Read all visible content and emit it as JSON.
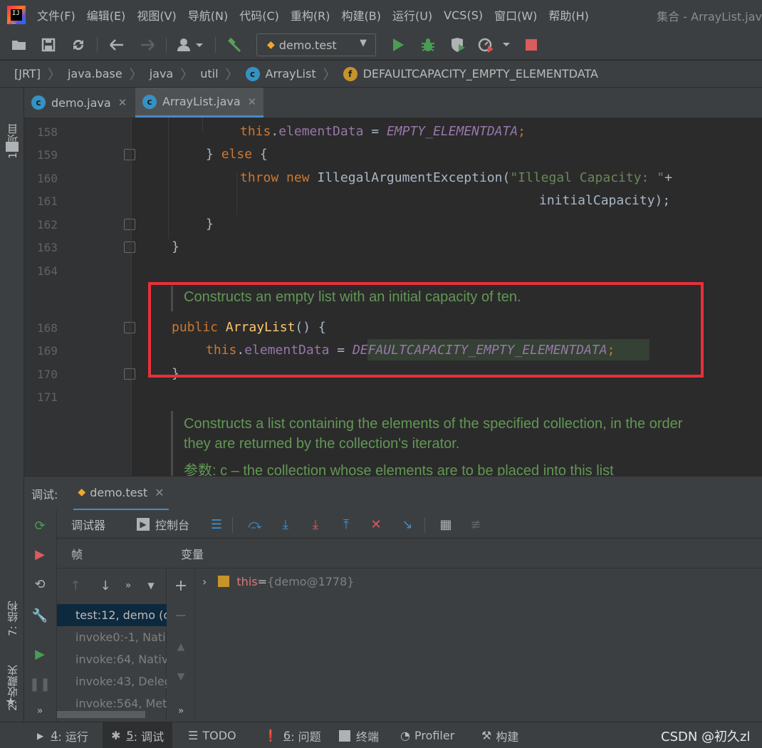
{
  "app": {
    "window_title": "集合 - ArrayList.jav"
  },
  "menu": [
    "文件(F)",
    "编辑(E)",
    "视图(V)",
    "导航(N)",
    "代码(C)",
    "重构(R)",
    "构建(B)",
    "运行(U)",
    "VCS(S)",
    "窗口(W)",
    "帮助(H)"
  ],
  "toolbar": {
    "run_config": "demo.test"
  },
  "breadcrumb": [
    "[JRT]",
    "java.base",
    "java",
    "util",
    "ArrayList",
    "DEFAULTCAPACITY_EMPTY_ELEMENTDATA"
  ],
  "left_strip": {
    "project": "1: 项目",
    "structure": "7: 结构",
    "favorites": "2: 收藏夹"
  },
  "tabs": [
    {
      "label": "demo.java"
    },
    {
      "label": "ArrayList.java"
    }
  ],
  "editor": {
    "line_numbers": [
      "158",
      "159",
      "160",
      "161",
      "162",
      "163",
      "164",
      "168",
      "169",
      "170",
      "171"
    ],
    "tokens": {
      "this": "this",
      "dot": ".",
      "elementData": "elementData",
      "eq": " = ",
      "empty_elementdata": "EMPTY_ELEMENTDATA",
      "semicolon": ";",
      "close_brace_else": "} ",
      "else": "else",
      "open_brace": " {",
      "throw": "throw",
      "new": "new",
      "exception": " IllegalArgumentException(",
      "illegal_capacity": "\"Illegal Capacity: \"",
      "plus": "+",
      "initial_capacity": "initialCapacity);",
      "close_brace": "}",
      "public": "public",
      "ctor_name": "ArrayList",
      "ctor_args": "() {",
      "default_capacity": "DEFAULTCAPACITY_EMPTY_ELEMENTDATA"
    },
    "doc_constructs_empty": "Constructs an empty list with an initial capacity of ten.",
    "doc_constructs_list_1": "Constructs a list containing the elements of the specified collection, in the order",
    "doc_constructs_list_2": "they are returned by the collection's iterator.",
    "doc_param_label": "参数:",
    "doc_param_text": " c – the collection whose elements are to be placed into this list"
  },
  "debug": {
    "label": "调试:",
    "session": "demo.test",
    "tab_debugger": "调试器",
    "tab_console": "控制台",
    "frames_header": "帧",
    "vars_header": "变量",
    "frames": [
      "test:12, demo (c",
      "invoke0:-1, Nati",
      "invoke:64, Nativ",
      "invoke:43, Deleg",
      "invoke:564, Met"
    ],
    "var_name": "this",
    "var_eq": " = ",
    "var_value": "{demo@1778}",
    "more": "»"
  },
  "statusbar": {
    "run_num": "4",
    "run": ": 运行",
    "debug_num": "5",
    "debug": ": 调试",
    "todo": "TODO",
    "problems_num": "6",
    "problems": ": 问题",
    "terminal": "终端",
    "profiler": "Profiler",
    "build": "构建",
    "watermark": "CSDN @初久zl"
  },
  "colors": {
    "highlight": "#e8303a",
    "keyword": "#cc7832",
    "field": "#9876aa",
    "doc": "#629755"
  }
}
